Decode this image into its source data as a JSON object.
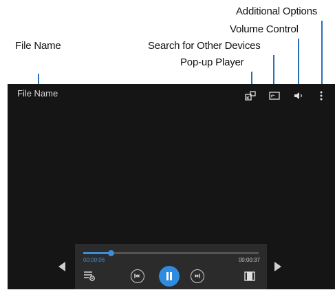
{
  "callouts": {
    "additional_options": "Additional Options",
    "volume_control": "Volume Control",
    "file_name": "File Name",
    "search_devices": "Search for Other Devices",
    "popup_player": "Pop-up Player"
  },
  "player": {
    "file_name": "File Name",
    "elapsed_time": "00:00:06",
    "total_time": "00:00:37",
    "progress": 0.16
  },
  "icons": {
    "popup": "popup-player-icon",
    "search_devices": "screen-mirroring-icon",
    "volume": "volume-icon",
    "options": "more-options-icon",
    "playlist": "playlist-icon",
    "previous": "previous-icon",
    "pause": "pause-icon",
    "next": "next-icon",
    "aspect": "aspect-ratio-icon"
  },
  "colors": {
    "accent": "#2d8be0",
    "screen_bg": "#151515",
    "leader_line": "#2a6fb5"
  }
}
